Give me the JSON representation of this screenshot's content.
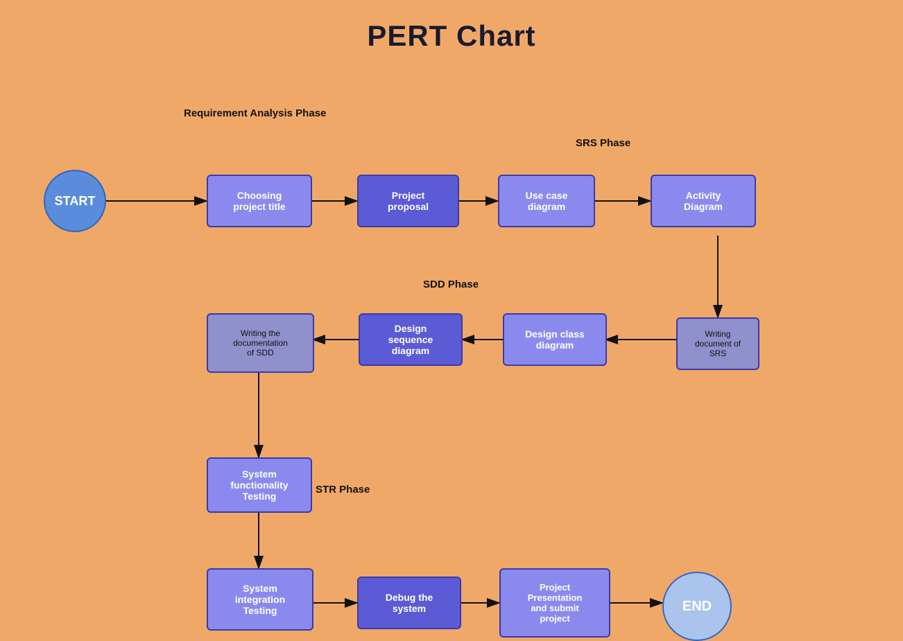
{
  "title": "PERT Chart",
  "phases": {
    "req_analysis": "Requirement\nAnalysis\nPhase",
    "srs": "SRS Phase",
    "sdd": "SDD Phase",
    "str": "STR Phase"
  },
  "nodes": {
    "start": "START",
    "end": "END",
    "choosing": "Choosing\nproject title",
    "proposal": "Project\nproposal",
    "usecase": "Use case\ndiagram",
    "activity": "Activity\nDiagram",
    "writing_srs": "Writing\ndocument of\nSRS",
    "design_class": "Design class\ndiagram",
    "design_seq": "Design\nsequence\ndiagram",
    "writing_sdd": "Writing the\ndocumentation\nof SDD",
    "sys_func": "System\nfunctionality\nTesting",
    "sys_int": "System\nintegration\nTesting",
    "debug": "Debug the\nsystem",
    "project_pres": "Project\nPresentation\nand submit\nproject"
  }
}
